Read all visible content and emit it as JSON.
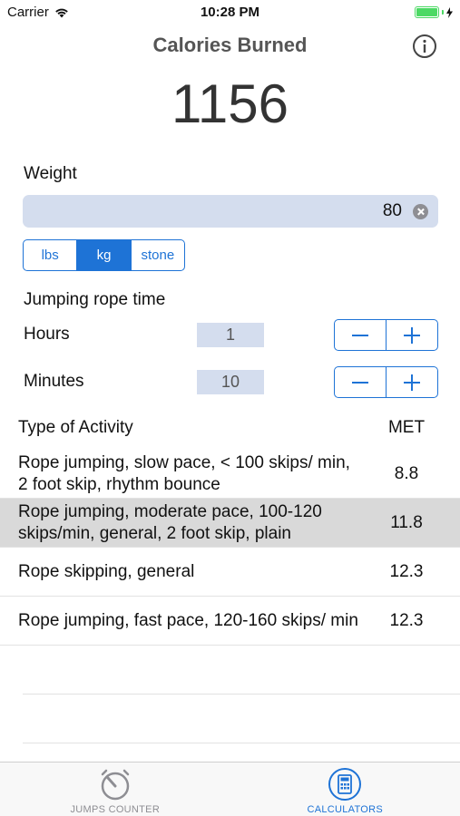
{
  "status_bar": {
    "carrier": "Carrier",
    "time": "10:28 PM",
    "battery_level": 1.0,
    "battery_color": "#4cd964"
  },
  "header": {
    "title": "Calories Burned",
    "info_icon": "info-circle-icon"
  },
  "calories_value": "1156",
  "weight": {
    "label": "Weight",
    "value": "80",
    "units": [
      {
        "label": "lbs",
        "selected": false
      },
      {
        "label": "kg",
        "selected": true
      },
      {
        "label": "stone",
        "selected": false
      }
    ]
  },
  "time": {
    "label": "Jumping rope time",
    "hours_label": "Hours",
    "hours_value": "1",
    "minutes_label": "Minutes",
    "minutes_value": "10"
  },
  "table": {
    "col_activity": "Type of Activity",
    "col_met": "MET",
    "rows": [
      {
        "activity": "Rope jumping, slow pace, < 100 skips/ min, 2 foot skip, rhythm bounce",
        "met": "8.8",
        "selected": false
      },
      {
        "activity": "Rope jumping, moderate pace, 100-120 skips/min, general, 2 foot skip, plain",
        "met": "11.8",
        "selected": true
      },
      {
        "activity": "Rope skipping, general",
        "met": "12.3",
        "selected": false
      },
      {
        "activity": "Rope jumping, fast pace, 120-160 skips/ min",
        "met": "12.3",
        "selected": false
      }
    ]
  },
  "tabs": [
    {
      "label": "JUMPS COUNTER",
      "icon": "stopwatch-icon",
      "active": false
    },
    {
      "label": "CALCULATORS",
      "icon": "calculator-icon",
      "active": true
    }
  ],
  "colors": {
    "accent": "#1e73d6",
    "field_bg": "#d4ddee",
    "selected_row": "#d9d9d9"
  }
}
